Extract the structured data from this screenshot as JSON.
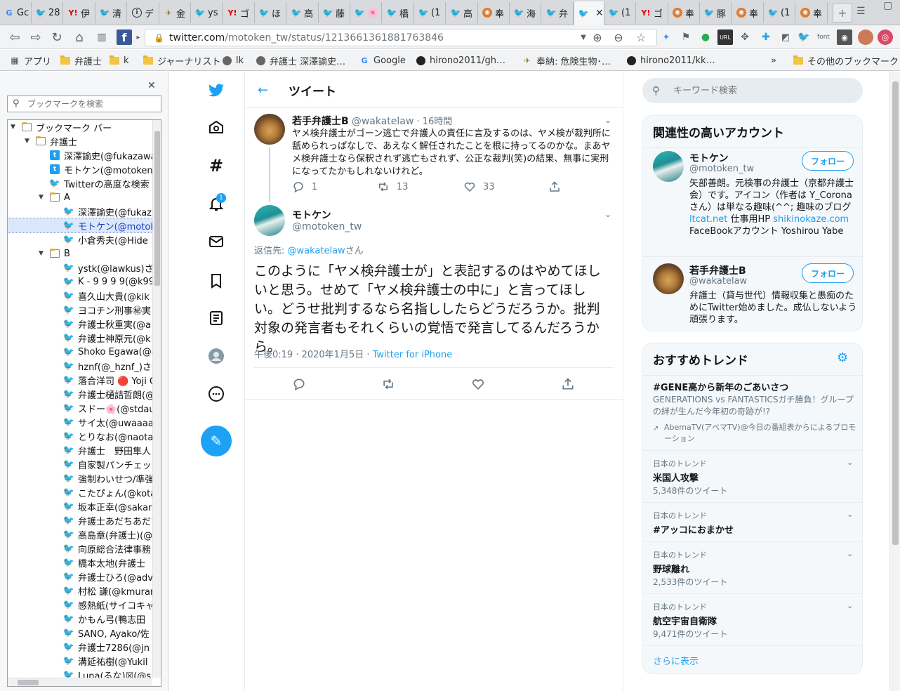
{
  "browser": {
    "tabs": [
      {
        "label": "Gc",
        "icon": "google-icon"
      },
      {
        "label": "28",
        "icon": "twitter-icon"
      },
      {
        "label": "伊",
        "icon": "yahoo-icon"
      },
      {
        "label": "清",
        "icon": "twitter-icon"
      },
      {
        "label": "デ",
        "icon": "info-icon"
      },
      {
        "label": "金",
        "icon": "bird-icon"
      },
      {
        "label": "ys",
        "icon": "twitter-icon"
      },
      {
        "label": "ゴ",
        "icon": "yahoo-icon"
      },
      {
        "label": "ほ",
        "icon": "twitter-icon"
      },
      {
        "label": "高",
        "icon": "twitter-icon"
      },
      {
        "label": "藤",
        "icon": "twitter-icon"
      },
      {
        "label": "🌸",
        "icon": "twitter-icon"
      },
      {
        "label": "橋",
        "icon": "twitter-icon"
      },
      {
        "label": "(1",
        "icon": "twitter-icon"
      },
      {
        "label": "高",
        "icon": "twitter-icon"
      },
      {
        "label": "奉",
        "icon": "mascot-icon"
      },
      {
        "label": "海",
        "icon": "twitter-icon"
      },
      {
        "label": "弁",
        "icon": "twitter-icon"
      },
      {
        "label": "",
        "icon": "twitter-icon",
        "active": true
      },
      {
        "label": "(1",
        "icon": "twitter-icon"
      },
      {
        "label": "ゴ",
        "icon": "yahoo-icon"
      },
      {
        "label": "奉",
        "icon": "mascot-icon"
      },
      {
        "label": "豚",
        "icon": "twitter-icon"
      },
      {
        "label": "奉",
        "icon": "mascot-icon"
      },
      {
        "label": "(1",
        "icon": "twitter-icon"
      },
      {
        "label": "奉",
        "icon": "mascot-icon"
      }
    ],
    "url_host": "twitter.com",
    "url_path": "/motoken_tw/status/1213661361881763846",
    "bookmarks_bar": [
      {
        "label": "アプリ",
        "icon": "apps-icon"
      },
      {
        "label": "弁護士",
        "icon": "folder-icon"
      },
      {
        "label": "k",
        "icon": "folder-icon"
      },
      {
        "label": "ジャーナリスト",
        "icon": "folder-icon"
      },
      {
        "label": "lk",
        "icon": "globe-icon"
      },
      {
        "label": "弁護士 深澤諭史…",
        "icon": "globe-icon"
      },
      {
        "label": "Google",
        "icon": "google-icon"
      },
      {
        "label": "hirono2011/gh…",
        "icon": "github-icon"
      },
      {
        "label": "奉納: 危険生物･…",
        "icon": "bird-icon"
      },
      {
        "label": "hirono2011/kk…",
        "icon": "github-icon"
      },
      {
        "label": "»",
        "icon": ""
      },
      {
        "label": "その他のブックマーク",
        "icon": "folder-icon"
      }
    ]
  },
  "sidebar": {
    "search_placeholder": "ブックマークを検索",
    "tree": [
      {
        "label": "ブックマーク バー",
        "type": "folder",
        "depth": 0
      },
      {
        "label": "弁護士",
        "type": "folder",
        "depth": 1
      },
      {
        "label": "深澤諭史(@fukazawa",
        "type": "tw-box",
        "depth": 2
      },
      {
        "label": "モトケン(@motoken_",
        "type": "tw-box",
        "depth": 2
      },
      {
        "label": "Twitterの高度な検索",
        "type": "bird",
        "depth": 2
      },
      {
        "label": "A",
        "type": "folder",
        "depth": 2
      },
      {
        "label": "深澤諭史(@fukaz",
        "type": "bird",
        "depth": 3
      },
      {
        "label": "モトケン(@motok",
        "type": "bird",
        "depth": 3,
        "selected": true
      },
      {
        "label": "小倉秀夫(@Hide",
        "type": "bird",
        "depth": 3
      },
      {
        "label": "B",
        "type": "folder",
        "depth": 2
      },
      {
        "label": "ystk(@lawkus)さん",
        "type": "bird",
        "depth": 3
      },
      {
        "label": "K - 9 9 9 9(@k99",
        "type": "bird",
        "depth": 3
      },
      {
        "label": "喜久山大貴(@kik",
        "type": "bird",
        "depth": 3
      },
      {
        "label": "ヨコチン刑事㊙実",
        "type": "bird",
        "depth": 3
      },
      {
        "label": "弁護士秋重実(@a",
        "type": "bird",
        "depth": 3
      },
      {
        "label": "弁護士神原元(@k",
        "type": "bird",
        "depth": 3
      },
      {
        "label": "Shoko Egawa(@a",
        "type": "bird",
        "depth": 3
      },
      {
        "label": "hznf(@_hznf_)さん",
        "type": "bird",
        "depth": 3
      },
      {
        "label": "落合洋司 🔴 Yoji O",
        "type": "bird",
        "depth": 3
      },
      {
        "label": "弁護士樋詰哲朗(@",
        "type": "bird",
        "depth": 3
      },
      {
        "label": "スドー🌸(@stdau",
        "type": "bird",
        "depth": 3
      },
      {
        "label": "サイ太(@uwaaaa)",
        "type": "bird",
        "depth": 3
      },
      {
        "label": "とりなお(@naotar",
        "type": "bird",
        "depth": 3
      },
      {
        "label": "弁護士　野田隼人",
        "type": "bird",
        "depth": 3
      },
      {
        "label": "自家製パンチェッタ",
        "type": "bird",
        "depth": 3
      },
      {
        "label": "強制わいせつ/準強",
        "type": "bird",
        "depth": 3
      },
      {
        "label": "こたぴょん(@kota",
        "type": "bird",
        "depth": 3
      },
      {
        "label": "坂本正幸(@sakar",
        "type": "bird",
        "depth": 3
      },
      {
        "label": "弁護士あだちあだち",
        "type": "bird",
        "depth": 3
      },
      {
        "label": "高島章(弁護士)(@",
        "type": "bird",
        "depth": 3
      },
      {
        "label": "向原総合法律事務",
        "type": "bird",
        "depth": 3
      },
      {
        "label": "橋本太地(弁護士",
        "type": "bird",
        "depth": 3
      },
      {
        "label": "弁護士ひろ(@adv",
        "type": "bird",
        "depth": 3
      },
      {
        "label": "村松 謙(@kmurar",
        "type": "bird",
        "depth": 3
      },
      {
        "label": "感熱紙(サイコキャ",
        "type": "bird",
        "depth": 3
      },
      {
        "label": "かもん弓(鴨志田",
        "type": "bird",
        "depth": 3
      },
      {
        "label": "SANO, Ayako/佐",
        "type": "bird",
        "depth": 3
      },
      {
        "label": "弁護士7286(@jn",
        "type": "bird",
        "depth": 3
      },
      {
        "label": "溝延祐樹(@Yukil",
        "type": "bird",
        "depth": 3
      },
      {
        "label": "Luna(るな)☒(@s",
        "type": "bird",
        "depth": 3
      }
    ]
  },
  "twitter": {
    "header_title": "ツイート",
    "nav_badge": "1",
    "parent_tweet": {
      "name": "若手弁護士B",
      "handle": "@wakatelaw",
      "time": "· 16時間",
      "text": "ヤメ検弁護士がゴーン逃亡で弁護人の責任に言及するのは、ヤメ検が裁判所に舐められっぱなしで、あえなく解任されたことを根に持ってるのかな。まあヤメ検弁護士なら保釈されず逃亡もされず、公正な裁判(笑)の結果、無事に実刑になってたかもしれないけれど。",
      "replies": "1",
      "retweets": "13",
      "likes": "33"
    },
    "main_tweet": {
      "name": "モトケン",
      "handle": "@motoken_tw",
      "reply_prefix": "返信先: ",
      "reply_to": "@wakatelaw",
      "reply_suffix": "さん",
      "text": "このように「ヤメ検弁護士が」と表記するのはやめてほしいと思う。せめて「ヤメ検弁護士の中に」と言ってほしい。どうせ批判するなら名指ししたらどうだろうか。批判対象の発言者もそれくらいの覚悟で発言してるんだろうから。",
      "meta": "午後0:19 · 2020年1月5日 · ",
      "source": "Twitter for iPhone"
    },
    "search_placeholder": "キーワード検索",
    "related": {
      "title": "関連性の高いアカウント",
      "follow_label": "フォロー",
      "accounts": [
        {
          "name": "モトケン",
          "handle": "@motoken_tw",
          "bio1": "矢部善朗。元検事の弁護士（京都弁護士会）です。アイコン（作者は Y_Coronaさん）は単なる趣味(^^; 趣味のブログ ",
          "link1": "ltcat.net",
          "bio2": " 仕事用HP ",
          "link2": "shikinokaze.com",
          "bio3": " FaceBookアカウント Yoshirou Yabe"
        },
        {
          "name": "若手弁護士B",
          "handle": "@wakatelaw",
          "bio1": "弁護士（貸与世代）情報収集と愚痴のためにTwitter始めました。成仏しないよう頑張ります。"
        }
      ]
    },
    "trends": {
      "title": "おすすめトレンド",
      "promoted": {
        "name": "#GENE高から新年のごあいさつ",
        "desc": "GENERATIONS vs FANTASTICSガチ勝負！グループの絆が生んだ今年初の奇跡が!?",
        "by": "AbemaTV(アベマTV)@今日の番組表からによるプロモーション"
      },
      "items": [
        {
          "category": "日本のトレンド",
          "name": "米国人攻撃",
          "count": "5,348件のツイート"
        },
        {
          "category": "日本のトレンド",
          "name": "#アッコにおまかせ",
          "count": ""
        },
        {
          "category": "日本のトレンド",
          "name": "野球離れ",
          "count": "2,533件のツイート"
        },
        {
          "category": "日本のトレンド",
          "name": "航空宇宙自衛隊",
          "count": "9,471件のツイート"
        }
      ],
      "show_more": "さらに表示"
    }
  }
}
